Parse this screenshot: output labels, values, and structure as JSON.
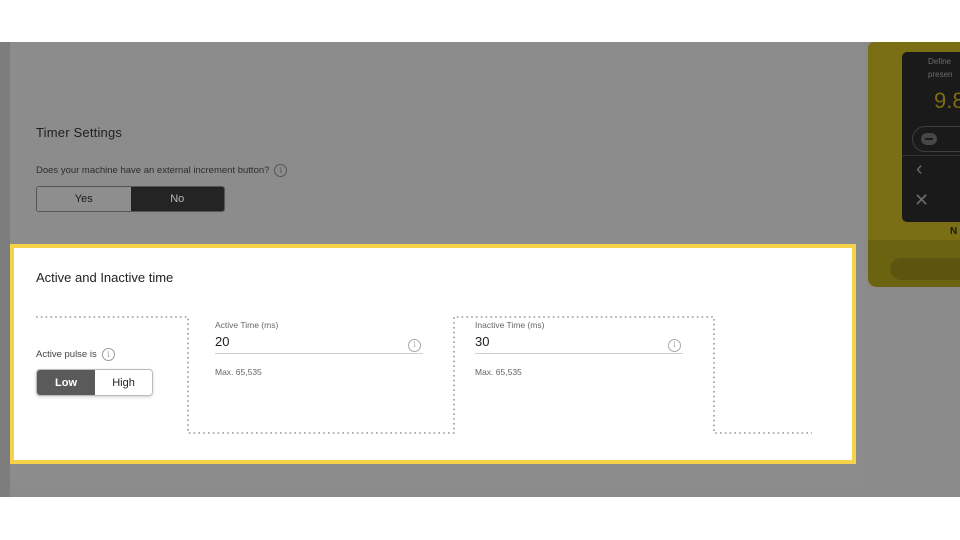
{
  "timer_settings": {
    "title": "Timer Settings",
    "question": "Does your machine have an external increment button?",
    "options": [
      "Yes",
      "No"
    ],
    "selected": "No"
  },
  "active_inactive": {
    "title": "Active and Inactive time",
    "pulse_label": "Active pulse is",
    "pulse_options": [
      "Low",
      "High"
    ],
    "pulse_selected": "Low",
    "active_time": {
      "label": "Active Time (ms)",
      "value": "20",
      "help": "Max. 65,535"
    },
    "inactive_time": {
      "label": "Inactive Time (ms)",
      "value": "30",
      "help": "Max. 65,535"
    }
  },
  "device": {
    "line1": "Define",
    "line2": "presen",
    "value": "9.8",
    "bottom_text": "N"
  },
  "colors": {
    "highlight_border": "#f6d24a",
    "selected_segment": "#5a5a5a",
    "dim_overlay": "#8a8a8a"
  }
}
